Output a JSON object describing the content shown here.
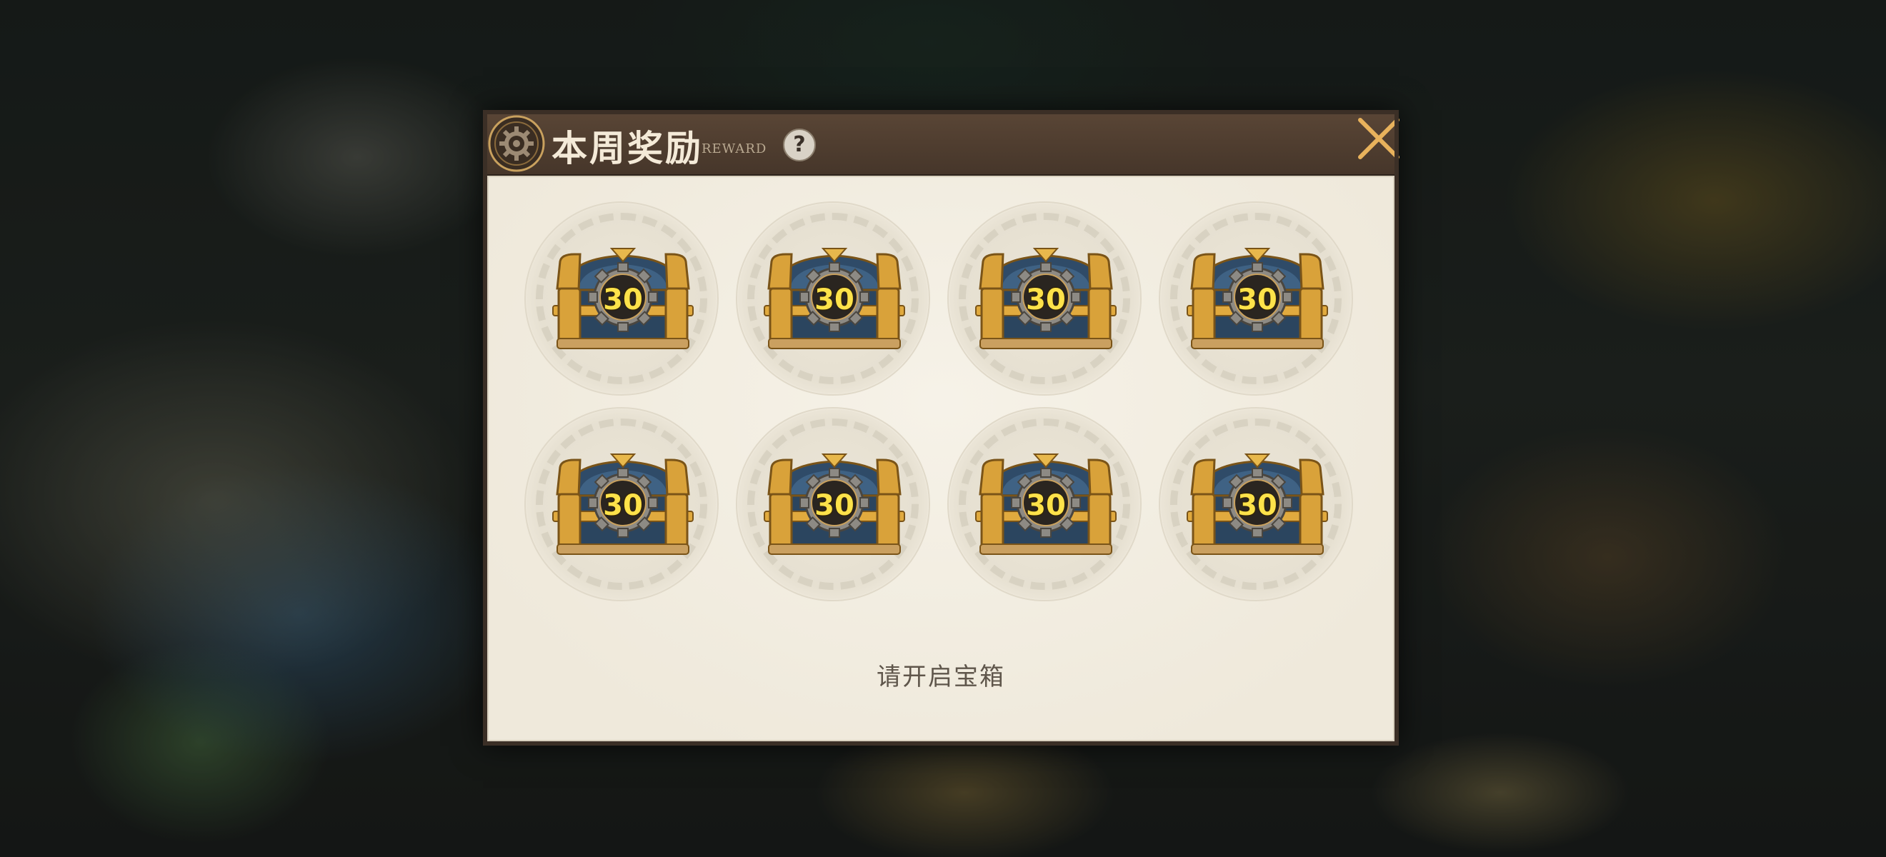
{
  "dialog": {
    "title": "本周奖励",
    "subtitle": "REWARD",
    "help_label": "?",
    "status": "请开启宝箱"
  },
  "chests": [
    {
      "label": "30",
      "icon": "treasure-chest-icon"
    },
    {
      "label": "30",
      "icon": "treasure-chest-icon"
    },
    {
      "label": "30",
      "icon": "treasure-chest-icon"
    },
    {
      "label": "30",
      "icon": "treasure-chest-icon"
    },
    {
      "label": "30",
      "icon": "treasure-chest-icon"
    },
    {
      "label": "30",
      "icon": "treasure-chest-icon"
    },
    {
      "label": "30",
      "icon": "treasure-chest-icon"
    },
    {
      "label": "30",
      "icon": "treasure-chest-icon"
    }
  ],
  "icons": {
    "emblem": "gear-emblem-icon",
    "close": "close-icon"
  },
  "colors": {
    "header": "#4f3d30",
    "body": "#efe9dc",
    "chest_gold": "#d9a23a",
    "chest_blue": "#2e4a66",
    "chest_number": "#fde24a",
    "close_x": "#e8b25c"
  }
}
